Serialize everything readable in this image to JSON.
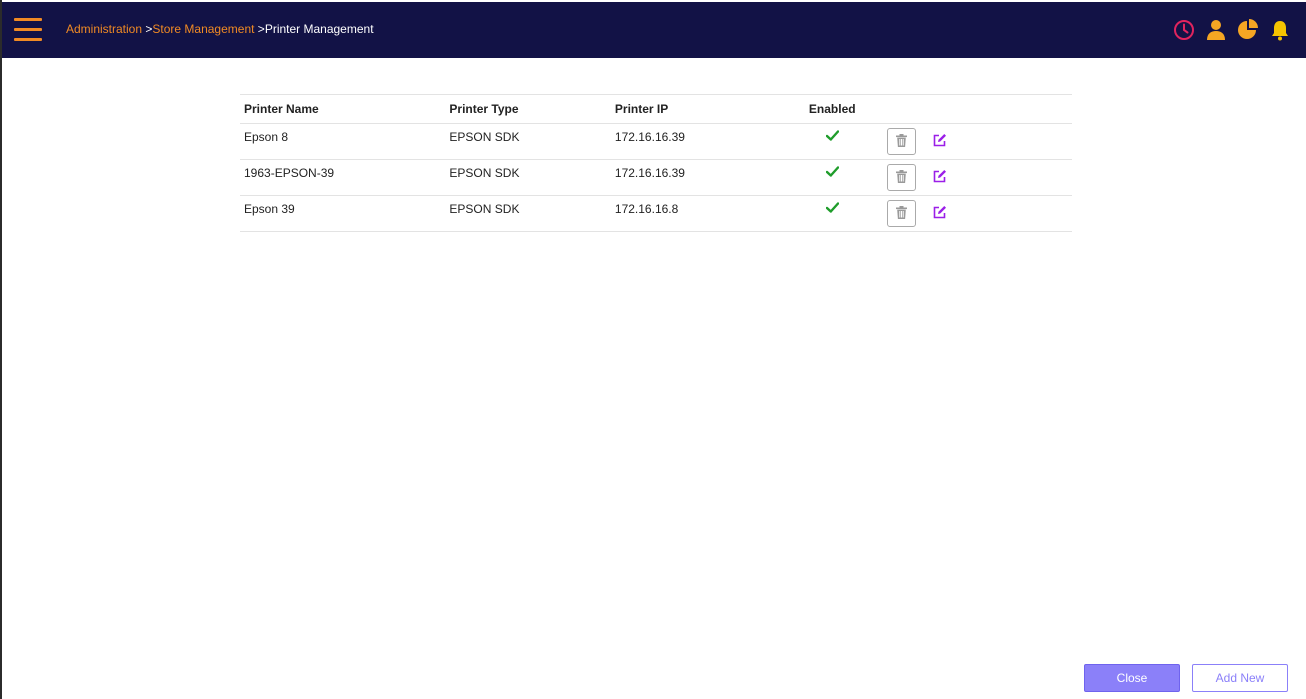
{
  "header": {
    "breadcrumb": {
      "items": [
        "Administration",
        "Store Management"
      ],
      "separator": ">",
      "current": "Printer Management"
    },
    "icons": [
      "clock-icon",
      "user-icon",
      "pie-chart-icon",
      "bell-icon"
    ],
    "colors": {
      "background": "#121246",
      "accent": "#f08a24",
      "clock": "#e0245e"
    }
  },
  "table": {
    "columns": {
      "name": "Printer Name",
      "type": "Printer Type",
      "ip": "Printer IP",
      "enabled": "Enabled"
    },
    "rows": [
      {
        "name": "Epson 8",
        "type": "EPSON SDK",
        "ip": "172.16.16.39",
        "enabled": true
      },
      {
        "name": "1963-EPSON-39",
        "type": "EPSON SDK",
        "ip": "172.16.16.39",
        "enabled": true
      },
      {
        "name": "Epson 39",
        "type": "EPSON SDK",
        "ip": "172.16.16.8",
        "enabled": true
      }
    ]
  },
  "footer": {
    "close_label": "Close",
    "add_new_label": "Add New"
  }
}
